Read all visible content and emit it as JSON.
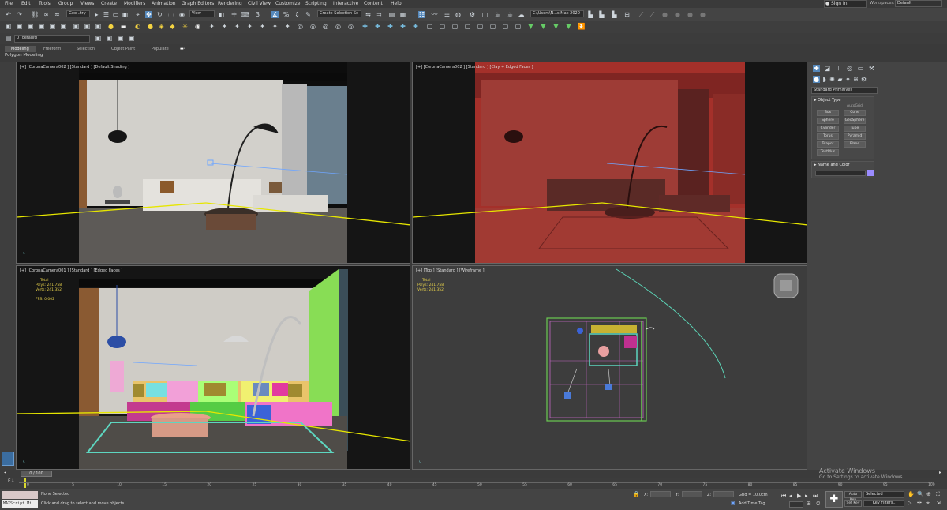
{
  "menu": [
    "File",
    "Edit",
    "Tools",
    "Group",
    "Views",
    "Create",
    "Modifiers",
    "Animation",
    "Graph Editors",
    "Rendering",
    "Civil View",
    "Customize",
    "Scripting",
    "Interactive",
    "Content",
    "Help"
  ],
  "account": {
    "signin": "Sign In",
    "workspaces_label": "Workspaces:",
    "workspace": "Default"
  },
  "toolbar": {
    "selection_filter": "Geo...try",
    "view_dropdown": "View",
    "named_selection": "Create Selection Se",
    "project_path": "C:\\Users\\N...s Max 2020",
    "layer": "0 (default)"
  },
  "ribbon": {
    "tabs": [
      "Modeling",
      "Freeform",
      "Selection",
      "Object Paint",
      "Populate"
    ],
    "subtitle": "Polygon Modeling"
  },
  "viewports": [
    {
      "label": "[+] [CoronaCamera002 ] [Standard ] [Default Shading ]"
    },
    {
      "label": "[+] [CoronaCamera002 ] [Standard ] [Clay + Edged Faces ]"
    },
    {
      "label": "[+] [CoronaCamera001 ] [Standard ] [Edged Faces ]",
      "stats": {
        "total": "Total",
        "polys_label": "Polys:",
        "polys": "241,758",
        "verts_label": "Verts:",
        "verts": "241,352",
        "fps_label": "FPS:",
        "fps": "0.002"
      }
    },
    {
      "label": "[+] [Top ] [Standard ] [Wireframe ]",
      "stats": {
        "total": "Total",
        "polys_label": "Polys:",
        "polys": "241,758",
        "verts_label": "Verts:",
        "verts": "241,352"
      }
    }
  ],
  "command_panel": {
    "category": "Standard Primitives",
    "object_type": "Object Type",
    "autogrid": "AutoGrid",
    "primitives": [
      "Box",
      "Cone",
      "Sphere",
      "GeoSphere",
      "Cylinder",
      "Tube",
      "Torus",
      "Pyramid",
      "Teapot",
      "Plane",
      "TextPlus"
    ],
    "name_color": "Name and Color",
    "swatch_color": "#9b8cff"
  },
  "timeline": {
    "frame": "0 / 100",
    "ticks": [
      "0",
      "5",
      "10",
      "15",
      "20",
      "25",
      "30",
      "35",
      "40",
      "45",
      "50",
      "55",
      "60",
      "65",
      "70",
      "75",
      "80",
      "85",
      "90",
      "95",
      "100"
    ]
  },
  "status": {
    "maxscript": "MAXScript Mi",
    "selection": "None Selected",
    "prompt": "Click and drag to select and move objects",
    "x_label": "X:",
    "y_label": "Y:",
    "z_label": "Z:",
    "grid": "Grid = 10.0cm",
    "add_time_tag": "Add Time Tag",
    "auto_key": "Auto Key",
    "set_key": "Set Key",
    "selected": "Selected",
    "key_filters": "Key Filters..."
  },
  "watermark": {
    "line1": "Activate Windows",
    "line2": "Go to Settings to activate Windows."
  }
}
